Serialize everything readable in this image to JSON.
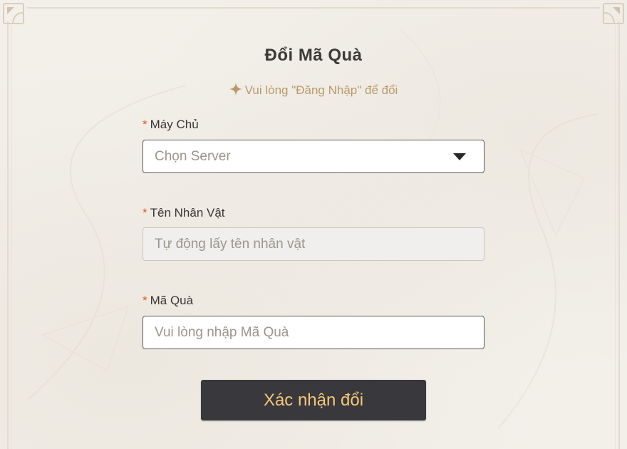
{
  "form": {
    "title": "Đổi Mã Quà",
    "login_hint": "Vui lòng \"Đăng Nhập\" để đổi",
    "required_mark": "*",
    "fields": {
      "server": {
        "label": "Máy Chủ",
        "value": "Chọn Server"
      },
      "character_name": {
        "label": "Tên Nhân Vật",
        "placeholder": "Tự động lấy tên nhân vật"
      },
      "gift_code": {
        "label": "Mã Quà",
        "placeholder": "Vui lòng nhập Mã Quà"
      }
    },
    "submit_label": "Xác nhận đổi"
  },
  "icons": {
    "hint": "sparkle-icon",
    "dropdown": "triangle-down-icon",
    "corners": "ornamental-corner-icon"
  },
  "colors": {
    "background": "#f3f0ea",
    "hint": "#b89a6a",
    "required": "#e0562c",
    "button_bg": "#38383d",
    "button_text": "#f3c878"
  }
}
